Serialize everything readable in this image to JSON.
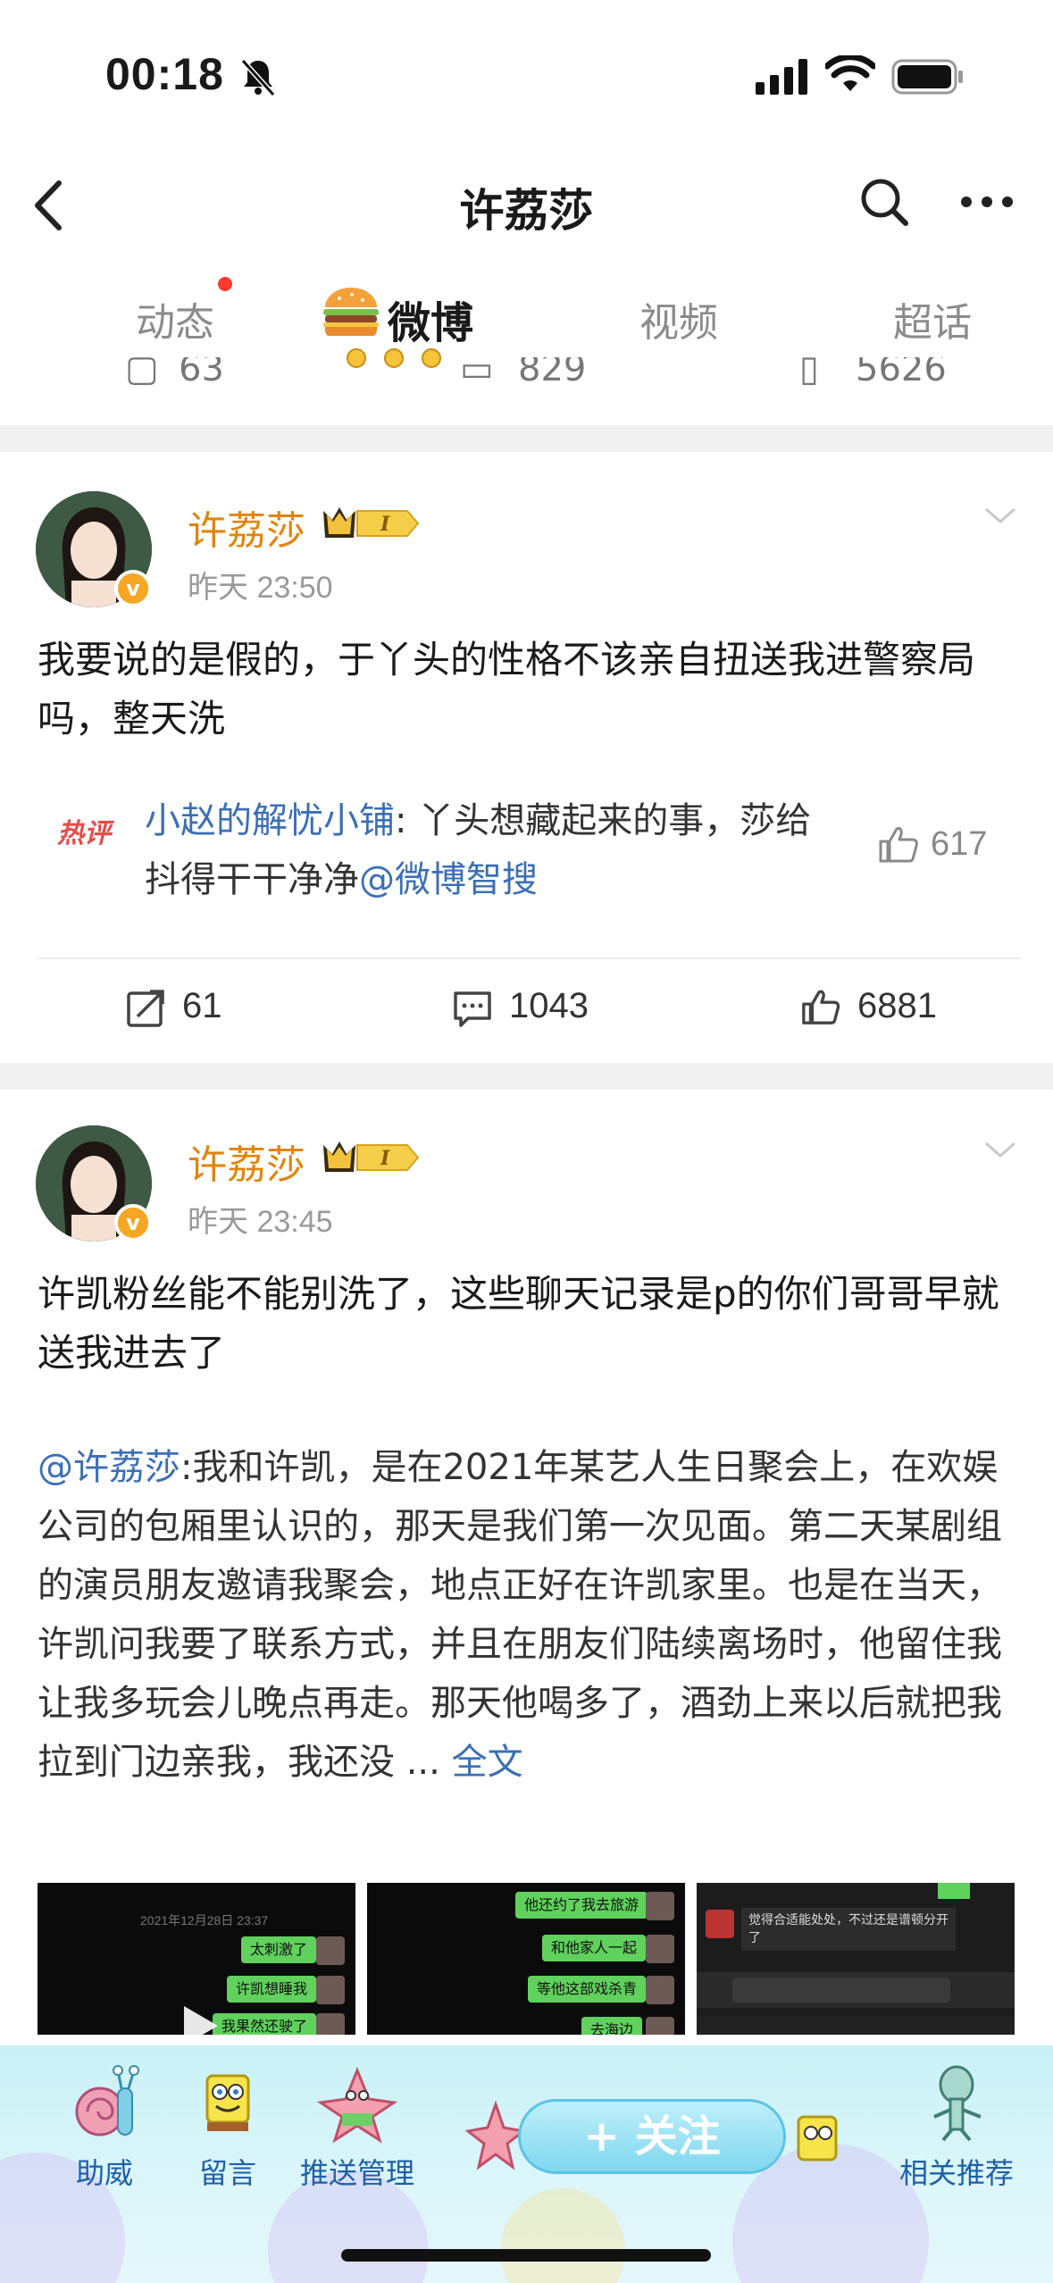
{
  "status_bar": {
    "time": "00:18"
  },
  "nav": {
    "title": "许荔莎"
  },
  "tabs": [
    {
      "label": "动态"
    },
    {
      "label": "微博"
    },
    {
      "label": "视频"
    },
    {
      "label": "超话"
    }
  ],
  "previous_post_stats": {
    "reposts": "63",
    "comments": "829",
    "likes": "5626"
  },
  "posts": [
    {
      "author": "许荔莎",
      "time": "昨天 23:50",
      "text": "我要说的是假的，于丫头的性格不该亲自扭送我进警察局吗，整天洗",
      "hot_comment": {
        "tag": "热评",
        "user": "小赵的解忧小铺",
        "text": ": 丫头想藏起来的事，莎给抖得干干净净",
        "mention": "@微博智搜",
        "likes": "617"
      },
      "reposts": "61",
      "comments": "1043",
      "likes": "6881"
    },
    {
      "author": "许荔莎",
      "time": "昨天 23:45",
      "text": "许凯粉丝能不能别洗了，这些聊天记录是p的你们哥哥早就送我进去了",
      "repost": {
        "mention": "@许荔莎",
        "text": ":我和许凯，是在2021年某艺人生日聚会上，在欢娱公司的包厢里认识的，那天是我们第一次见面。第二天某剧组的演员朋友邀请我聚会，地点正好在许凯家里。也是在当天，许凯问我要了联系方式，并且在朋友们陆续离场时，他留住我让我多玩会儿晚点再走。那天他喝多了，酒劲上来以后就把我拉到门边亲我，我还没 ... ",
        "more": "全文"
      },
      "images": [
        {
          "bubbles": [
            "太刺激了",
            "许凯想睡我",
            "我果然还驶了"
          ],
          "date": "2021年12月28日 23:37"
        },
        {
          "bubbles": [
            "他还约了我去旅游",
            "和他家人一起",
            "等他这部戏杀青",
            "去海边"
          ]
        },
        {
          "text": "觉得合适能处处，不过还是谱顿分开了"
        }
      ]
    }
  ],
  "bottom_bar": {
    "items": [
      {
        "label": "助威"
      },
      {
        "label": "留言"
      },
      {
        "label": "推送管理"
      },
      {
        "label": "相关推荐"
      }
    ],
    "follow_label": "+ 关注"
  },
  "colors": {
    "author": "#e0850c",
    "link": "#3a6fb5",
    "hot_tag": "#e64b4b"
  }
}
